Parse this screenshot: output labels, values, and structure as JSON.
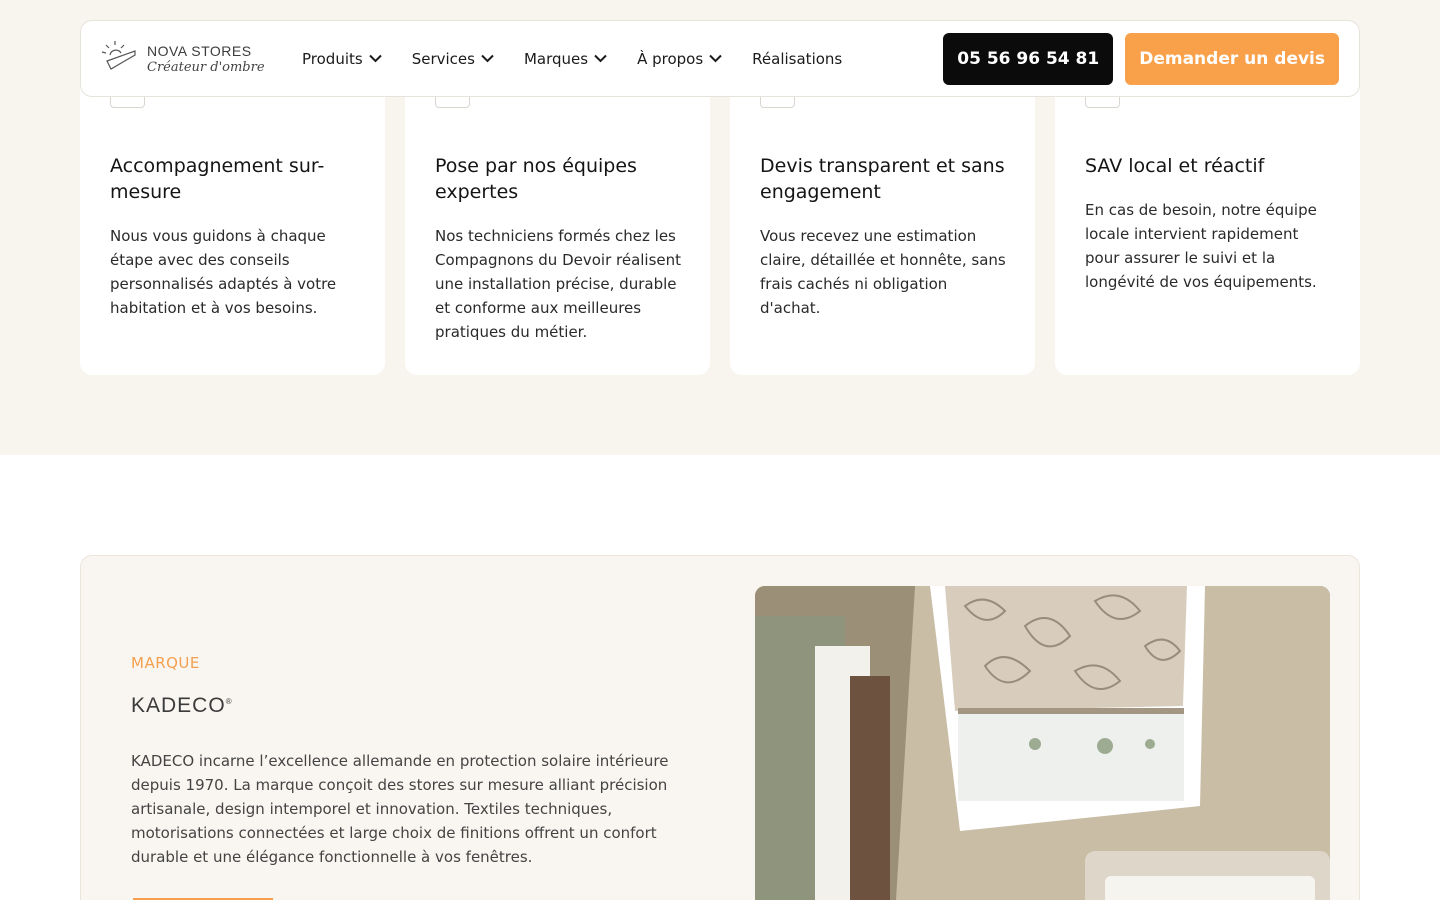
{
  "header": {
    "logo": {
      "name": "NOVA STORES",
      "tagline": "Créateur d'ombre"
    },
    "nav": [
      {
        "label": "Produits",
        "dropdown": true
      },
      {
        "label": "Services",
        "dropdown": true
      },
      {
        "label": "Marques",
        "dropdown": true
      },
      {
        "label": "À propos",
        "dropdown": true
      },
      {
        "label": "Réalisations",
        "dropdown": false
      }
    ],
    "phone": "05 56 96 54 81",
    "quote_cta": "Demander un devis"
  },
  "features": [
    {
      "icon": "arrow-icon",
      "title": "Accompagnement sur-mesure",
      "text": "Nous vous guidons à chaque étape avec des conseils personnalisés adaptés à votre habitation et à vos besoins."
    },
    {
      "icon": "tools-icon",
      "title": "Pose par nos équipes expertes",
      "text": "Nos techniciens formés chez les Compagnons du Devoir réalisent une installation précise, durable et conforme aux meilleures pratiques du métier."
    },
    {
      "icon": "shield-icon",
      "title": "Devis transparent et sans engagement",
      "text": "Vous recevez une estimation claire, détaillée et honnête, sans frais cachés ni obligation d'achat."
    },
    {
      "icon": "support-icon",
      "title": "SAV local et réactif",
      "text": "En cas de besoin, notre équipe locale intervient rapidement pour assurer le suivi et la longévité de vos équipements."
    }
  ],
  "brand": {
    "eyebrow": "MARQUE",
    "logo": "KADECO",
    "description": "KADECO incarne l’excellence allemande en protection solaire intérieure depuis 1970. La marque conçoit des stores sur mesure alliant précision artisanale, design intemporel et innovation. Textiles techniques, motorisations connectées et large choix de finitions offrent un confort durable et une élégance fonctionnelle à vos fenêtres."
  },
  "colors": {
    "accent": "#f9a04b",
    "dark_button": "#0b0b0b",
    "band_background": "#f8f5ef"
  }
}
